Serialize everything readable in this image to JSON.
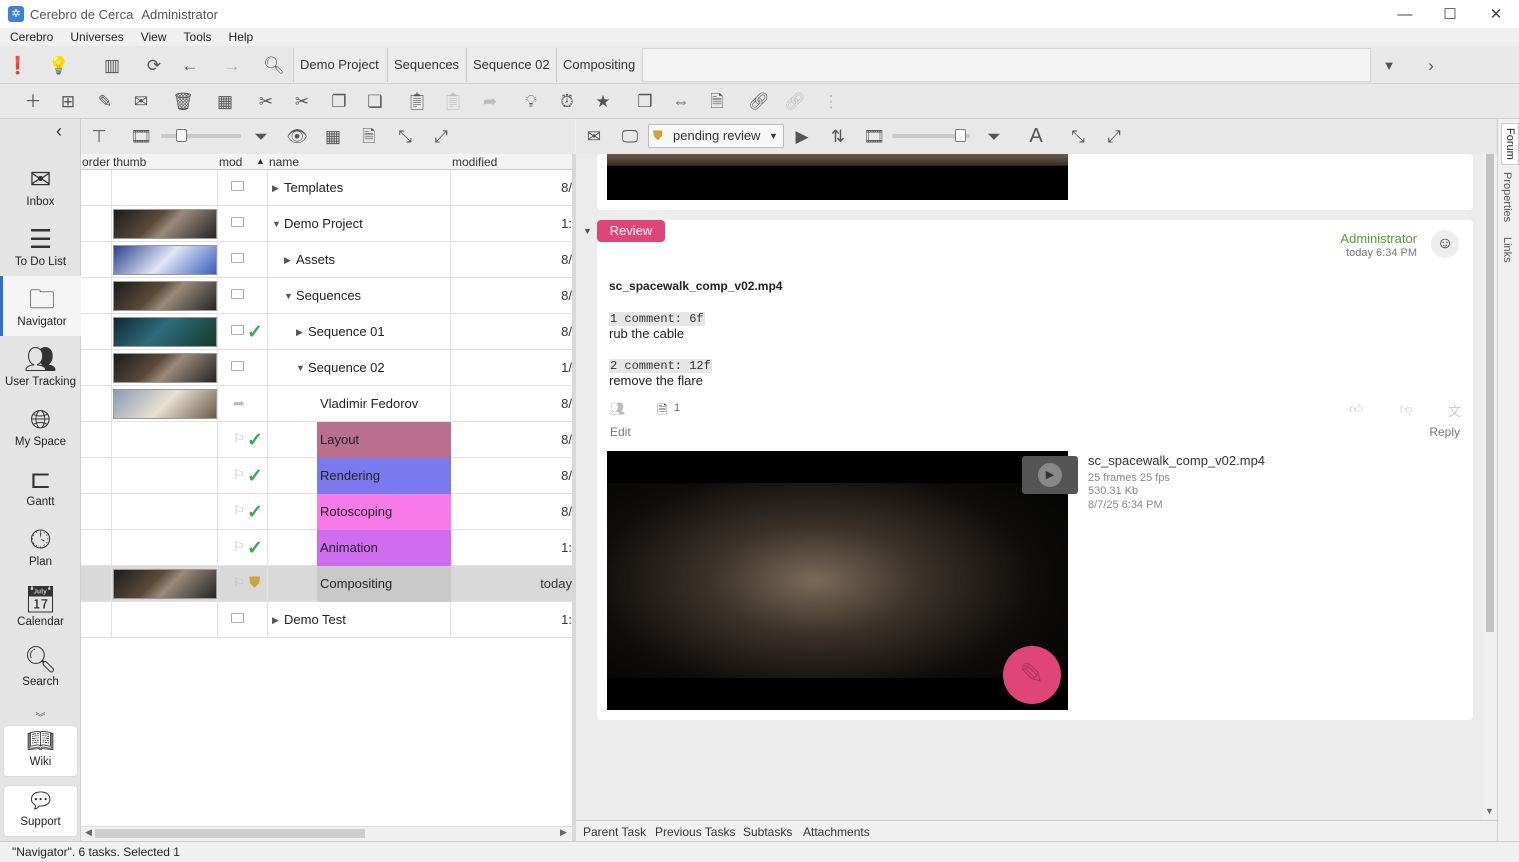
{
  "window": {
    "app_name": "Cerebro de Cerca",
    "user": "Administrator"
  },
  "menu": [
    "Cerebro",
    "Universes",
    "View",
    "Tools",
    "Help"
  ],
  "breadcrumb": [
    "Demo Project",
    "Sequences",
    "Sequence 02",
    "Compositing"
  ],
  "sidebar": {
    "items": [
      {
        "label": "Inbox",
        "icon": "inbox-icon"
      },
      {
        "label": "To Do List",
        "icon": "list-icon"
      },
      {
        "label": "Navigator",
        "icon": "folder-icon"
      },
      {
        "label": "User Tracking",
        "icon": "users-icon"
      },
      {
        "label": "My Space",
        "icon": "globe-icon"
      },
      {
        "label": "Gantt",
        "icon": "gantt-icon"
      },
      {
        "label": "Plan",
        "icon": "clock-plus-icon"
      },
      {
        "label": "Calendar",
        "icon": "calendar-icon"
      },
      {
        "label": "Search",
        "icon": "search-icon"
      }
    ],
    "wiki": "Wiki",
    "support": "Support"
  },
  "tree": {
    "columns": [
      "order",
      "thumb",
      "mod",
      "name",
      "modified"
    ],
    "rows": [
      {
        "name": "Templates",
        "modified": "8/",
        "thumb": false,
        "status": "folder"
      },
      {
        "name": "Demo Project",
        "modified": "1:",
        "thumb": true,
        "status": "folder"
      },
      {
        "name": "Assets",
        "modified": "8/",
        "thumb": true,
        "status": "folder"
      },
      {
        "name": "Sequences",
        "modified": "8/",
        "thumb": true,
        "status": "folder"
      },
      {
        "name": "Sequence 01",
        "modified": "8/",
        "thumb": true,
        "status": "check"
      },
      {
        "name": "Sequence 02",
        "modified": "1/",
        "thumb": true,
        "status": "folder"
      },
      {
        "name": "Vladimir Fedorov",
        "modified": "8/",
        "thumb": true,
        "status": "forward"
      },
      {
        "name": "Layout",
        "modified": "8/",
        "thumb": false,
        "status": "check"
      },
      {
        "name": "Rendering",
        "modified": "8/",
        "thumb": false,
        "status": "check"
      },
      {
        "name": "Rotoscoping",
        "modified": "8/",
        "thumb": false,
        "status": "check"
      },
      {
        "name": "Animation",
        "modified": "1:",
        "thumb": false,
        "status": "check"
      },
      {
        "name": "Compositing",
        "modified": "today",
        "thumb": true,
        "status": "stamp"
      },
      {
        "name": "Demo Test",
        "modified": "1:",
        "thumb": false,
        "status": "folder"
      }
    ]
  },
  "status_filter": "pending review",
  "review": {
    "tag": "Review",
    "author": "Administrator",
    "time": "today 6:34 PM",
    "file": "sc_spacewalk_comp_v02.mp4",
    "comments": [
      {
        "ref": "1 comment: 6f",
        "text": "rub the cable"
      },
      {
        "ref": "2 comment: 12f",
        "text": "remove the flare"
      }
    ],
    "attachments_count": "1",
    "edit": "Edit",
    "reply": "Reply",
    "video": {
      "name": "sc_spacewalk_comp_v02.mp4",
      "frames": "25 frames 25 fps",
      "size": "530.31 Kb",
      "date": "8/7/25 6:34 PM"
    }
  },
  "footer_tabs": [
    "Parent Task",
    "Previous Tasks",
    "Subtasks",
    "Attachments"
  ],
  "side_tabs": [
    "Forum",
    "Properties",
    "Links"
  ],
  "statusbar": "\"Navigator\". 6 tasks. Selected 1",
  "colors": {
    "accent": "#2f6fd1",
    "review_tag": "#e0457a",
    "author": "#5a9a3a",
    "check": "#3aa84d",
    "layout": "#b9708f",
    "rendering": "#7a7af0",
    "rotoscoping": "#f77ae8",
    "animation": "#d06cf0"
  }
}
